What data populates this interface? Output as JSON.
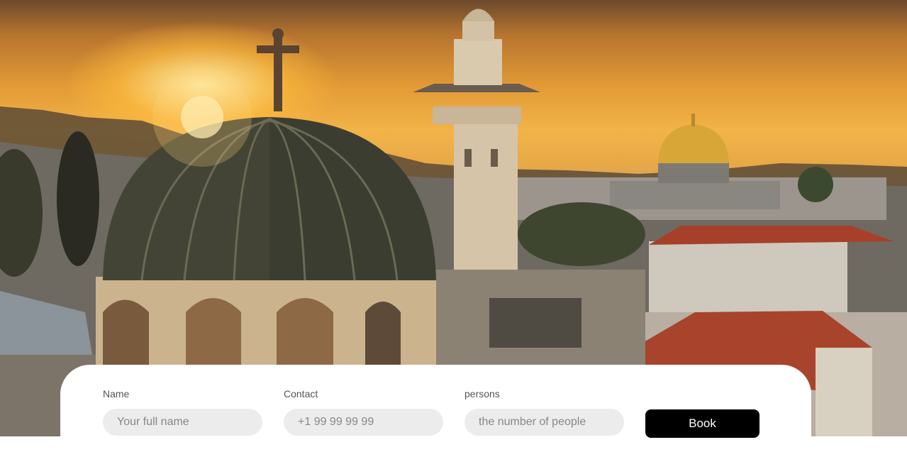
{
  "hero": {
    "image_alt": "Jerusalem old city skyline at sunset"
  },
  "booking": {
    "name": {
      "label": "Name",
      "placeholder": "Your full name"
    },
    "contact": {
      "label": "Contact",
      "placeholder": "+1 99 99 99 99"
    },
    "persons": {
      "label": "persons",
      "placeholder": "the number of people"
    },
    "book_label": "Book"
  },
  "colors": {
    "button_bg": "#000000",
    "input_bg": "#ececec",
    "card_bg": "#ffffff"
  }
}
